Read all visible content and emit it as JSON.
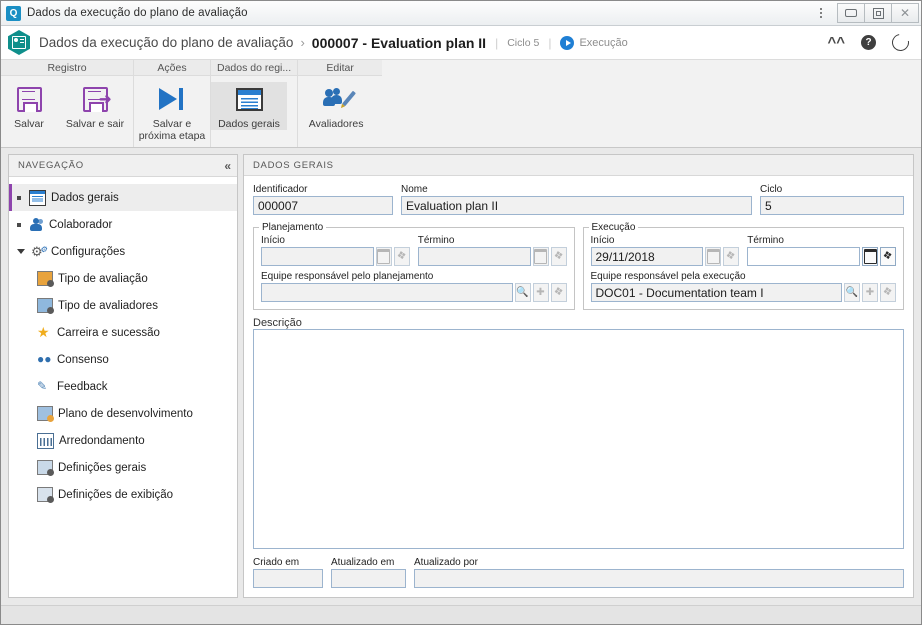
{
  "window": {
    "title": "Dados da execução do plano de avaliação",
    "app_icon": "app-icon",
    "controls": {
      "more": "⋮",
      "minimize": "minimize",
      "maximize": "maximize",
      "close": "close"
    }
  },
  "header": {
    "module_icon": "id-badge-icon",
    "breadcrumb_root": "Dados da execução do plano de avaliação",
    "breadcrumb_separator": "›",
    "breadcrumb_current": "000007 - Evaluation plan II",
    "divider": "|",
    "cycle": "Ciclo 5",
    "stage": "Execução",
    "actions": {
      "collapse": "chevron-up",
      "help": "?",
      "refresh": "refresh"
    }
  },
  "ribbon": {
    "groups": [
      {
        "title": "Registro",
        "buttons": [
          {
            "label": "Salvar",
            "icon": "save-floppy-icon"
          },
          {
            "label": "Salvar e sair",
            "icon": "save-exit-floppy-icon"
          }
        ]
      },
      {
        "title": "Ações",
        "buttons": [
          {
            "label": "Salvar e\npróxima etapa",
            "label_line1": "Salvar e",
            "label_line2": "próxima etapa",
            "icon": "next-step-icon"
          }
        ]
      },
      {
        "title": "Dados do regi...",
        "buttons": [
          {
            "label": "Dados gerais",
            "icon": "general-data-icon",
            "selected": true
          }
        ]
      },
      {
        "title": "Editar",
        "buttons": [
          {
            "label": "Avaliadores",
            "icon": "evaluators-icon"
          }
        ]
      }
    ]
  },
  "sidebar": {
    "title": "NAVEGAÇÃO",
    "collapse_glyph": "«",
    "items": [
      {
        "label": "Dados gerais",
        "icon": "general-data-icon",
        "level": "top",
        "marker": "bullet",
        "active": true
      },
      {
        "label": "Colaborador",
        "icon": "user-icon",
        "level": "top",
        "marker": "bullet",
        "active": false
      },
      {
        "label": "Configurações",
        "icon": "gear-icon",
        "level": "top",
        "marker": "caret",
        "active": false
      },
      {
        "label": "Tipo de avaliação",
        "icon": "evaluation-type-icon",
        "level": "child",
        "active": false
      },
      {
        "label": "Tipo de avaliadores",
        "icon": "evaluator-type-icon",
        "level": "child",
        "active": false
      },
      {
        "label": "Carreira e sucessão",
        "icon": "career-star-icon",
        "level": "child",
        "active": false
      },
      {
        "label": "Consenso",
        "icon": "consensus-icon",
        "level": "child",
        "active": false
      },
      {
        "label": "Feedback",
        "icon": "feedback-icon",
        "level": "child",
        "active": false
      },
      {
        "label": "Plano de desenvolvimento",
        "icon": "development-plan-icon",
        "level": "child",
        "active": false
      },
      {
        "label": "Arredondamento",
        "icon": "rounding-calculator-icon",
        "level": "child",
        "active": false
      },
      {
        "label": "Definições gerais",
        "icon": "general-settings-icon",
        "level": "child",
        "active": false
      },
      {
        "label": "Definições de exibição",
        "icon": "display-settings-icon",
        "level": "child",
        "active": false
      }
    ]
  },
  "main": {
    "section_title": "DADOS GERAIS",
    "identificador": {
      "label": "Identificador",
      "value": "000007"
    },
    "nome": {
      "label": "Nome",
      "value": "Evaluation plan II"
    },
    "ciclo": {
      "label": "Ciclo",
      "value": "5"
    },
    "planejamento": {
      "legend": "Planejamento",
      "inicio": {
        "label": "Início",
        "value": ""
      },
      "termino": {
        "label": "Término",
        "value": ""
      },
      "equipe": {
        "label": "Equipe responsável pelo planejamento",
        "value": ""
      },
      "buttons": {
        "calendar": "calendar-icon",
        "eraser": "eraser-icon",
        "search": "search-icon",
        "add": "add-icon"
      }
    },
    "execucao": {
      "legend": "Execução",
      "inicio": {
        "label": "Início",
        "value": "29/11/2018"
      },
      "termino": {
        "label": "Término",
        "value": ""
      },
      "equipe": {
        "label": "Equipe responsável pela execução",
        "value": "DOC01 - Documentation team I"
      },
      "buttons": {
        "calendar": "calendar-icon",
        "eraser": "eraser-icon",
        "search": "search-icon",
        "add": "add-icon"
      }
    },
    "descricao": {
      "label": "Descrição",
      "value": ""
    },
    "criado_em": {
      "label": "Criado em",
      "value": ""
    },
    "atualizado_em": {
      "label": "Atualizado em",
      "value": ""
    },
    "atualizado_por": {
      "label": "Atualizado por",
      "value": ""
    }
  },
  "colors": {
    "accent_purple": "#8e44ad",
    "accent_blue": "#2273c4",
    "module_teal": "#0f8f8b",
    "field_border": "#9cb4ce",
    "field_bg": "#f1f1f1"
  }
}
